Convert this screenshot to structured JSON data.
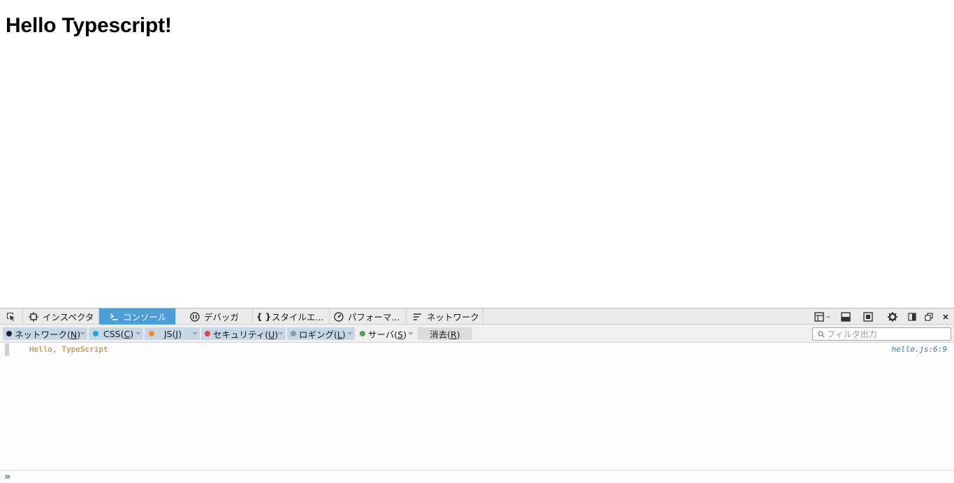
{
  "page": {
    "heading": "Hello Typescript!"
  },
  "devtools": {
    "tabs": [
      {
        "label": "インスペクタ",
        "icon": "inspector-icon"
      },
      {
        "label": "コンソール",
        "icon": "console-icon",
        "active": true
      },
      {
        "label": "デバッガ",
        "icon": "debugger-icon"
      },
      {
        "label": "スタイルエ...",
        "icon": "style-editor-icon"
      },
      {
        "label": "パフォーマ...",
        "icon": "performance-icon"
      },
      {
        "label": "ネットワーク",
        "icon": "network-icon"
      }
    ],
    "filters": [
      {
        "label_a": "ネットワーク(",
        "key": "N",
        "label_b": ")",
        "color": "#222222"
      },
      {
        "label_a": "CSS(",
        "key": "C",
        "label_b": ")",
        "color": "#1ea6e1"
      },
      {
        "label_a": "JS(",
        "key": "J",
        "label_b": ")",
        "color": "#f58c22"
      },
      {
        "label_a": "セキュリティ(",
        "key": "U",
        "label_b": ")",
        "color": "#e94048"
      },
      {
        "label_a": "ロギング(",
        "key": "L",
        "label_b": ")",
        "color": "#8a9aa8"
      },
      {
        "label_a": "サーバ(",
        "key": "S",
        "label_b": ")",
        "color": "#5a9b50"
      }
    ],
    "clear": {
      "label_a": "消去(",
      "key": "R",
      "label_b": ")"
    },
    "search": {
      "placeholder": "フィルタ出力"
    },
    "log": [
      {
        "message": "Hello, TypeScript",
        "location": "hello.js:6:9"
      }
    ],
    "prompt": "»"
  }
}
